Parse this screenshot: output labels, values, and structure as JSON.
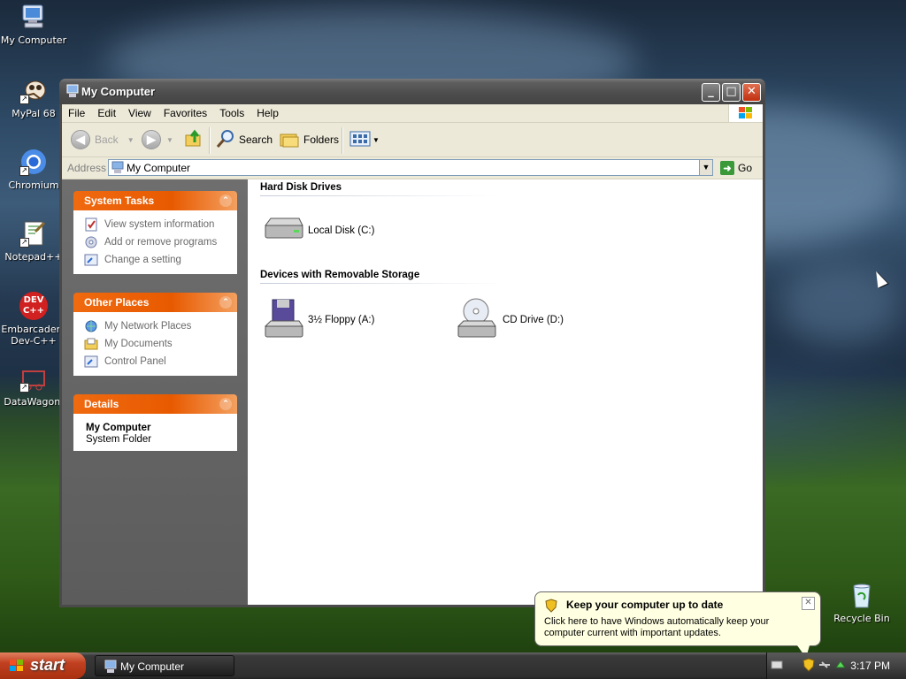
{
  "desktop": {
    "icons": [
      {
        "label": "My Computer"
      },
      {
        "label": "MyPal 68"
      },
      {
        "label": "Chromium"
      },
      {
        "label": "Notepad++"
      },
      {
        "label_line1": "Embarcadero",
        "label_line2": "Dev-C++",
        "logo_text": "DEV",
        "logo_sub": "C++"
      },
      {
        "label": "DataWagon."
      },
      {
        "label": "Recycle Bin"
      }
    ]
  },
  "window": {
    "title": "My Computer",
    "controls": {
      "minimize": "_",
      "maximize": "□",
      "close": "✕"
    },
    "menu": [
      "File",
      "Edit",
      "View",
      "Favorites",
      "Tools",
      "Help"
    ],
    "toolbar": {
      "back": "Back",
      "search": "Search",
      "folders": "Folders"
    },
    "address": {
      "label": "Address",
      "value": "My Computer",
      "go": "Go"
    }
  },
  "sidebar": {
    "system_tasks": {
      "title": "System Tasks",
      "items": [
        "View system information",
        "Add or remove programs",
        "Change a setting"
      ]
    },
    "other_places": {
      "title": "Other Places",
      "items": [
        "My Network Places",
        "My Documents",
        "Control Panel"
      ]
    },
    "details": {
      "title": "Details",
      "name": "My Computer",
      "type": "System Folder"
    }
  },
  "content": {
    "hard_disks": {
      "title": "Hard Disk Drives",
      "items": [
        "Local Disk (C:)"
      ]
    },
    "removable": {
      "title": "Devices with Removable Storage",
      "items": [
        "3½ Floppy (A:)",
        "CD Drive (D:)"
      ]
    }
  },
  "taskbar": {
    "start_label": "start",
    "task_button": "My Computer",
    "clock": "3:17 PM"
  },
  "balloon": {
    "title": "Keep your computer up to date",
    "text": "Click here to have Windows automatically keep your computer current with important updates.",
    "close": "✕"
  },
  "colors": {
    "panel_header": "#e85a00",
    "title_bar": "#4c4c4c",
    "balloon_bg": "#ffffe1"
  }
}
